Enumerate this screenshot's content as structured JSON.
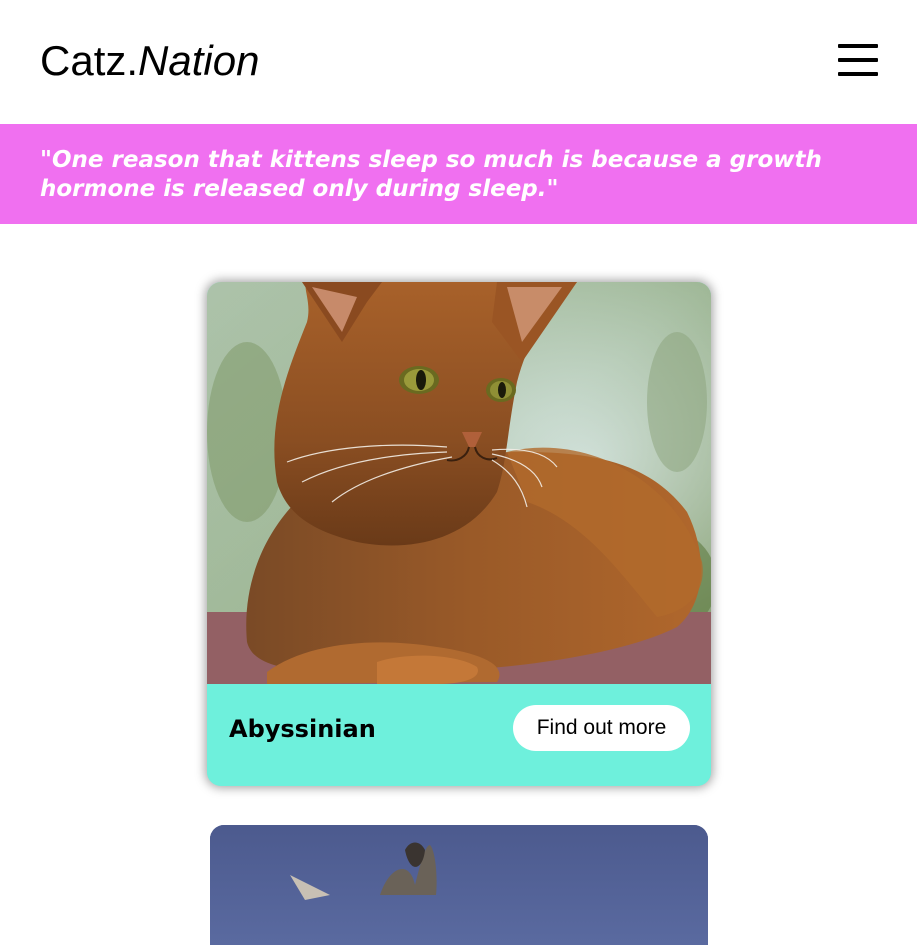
{
  "header": {
    "logo_plain": "Catz.",
    "logo_italic": "Nation",
    "menu_icon": "hamburger-menu-icon"
  },
  "quote": {
    "text": "\"One reason that kittens sleep so much is because a growth hormone is released only during sleep.\""
  },
  "cards": [
    {
      "title": "Abyssinian",
      "button_label": "Find out more",
      "image": "abyssinian-cat-photo"
    },
    {
      "image": "cat-photo-partial"
    }
  ],
  "colors": {
    "banner": "#f070f0",
    "card_footer": "#6ef0dc",
    "button_bg": "#ffffff"
  }
}
